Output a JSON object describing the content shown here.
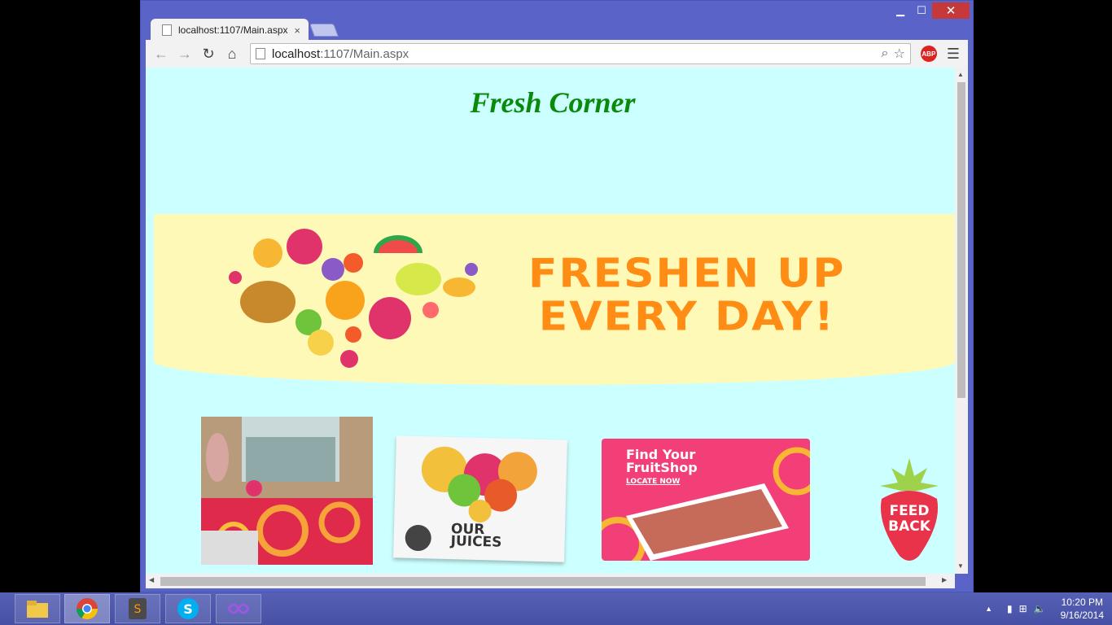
{
  "browser": {
    "tab_title": "localhost:1107/Main.aspx",
    "tab_close": "×",
    "url_host": "localhost",
    "url_rest": ":1107/Main.aspx",
    "abp_label": "ABP"
  },
  "page": {
    "site_title": "Fresh Corner",
    "banner_line1": "FRESHEN UP",
    "banner_line2": "EVERY DAY!",
    "juices_line1": "OUR",
    "juices_line2": "JUICES",
    "find_line1": "Find Your",
    "find_line2": "FruitShop",
    "find_sub": "LOCATE NOW",
    "feedback_line1": "FEED",
    "feedback_line2": "BACK"
  },
  "taskbar": {
    "apps": [
      "file-explorer",
      "chrome",
      "sublime-text",
      "skype",
      "visual-studio"
    ],
    "time": "10:20 PM",
    "date": "9/16/2014"
  },
  "colors": {
    "page_bg": "#ccffff",
    "title_green": "#0a8a0a",
    "banner_bg": "#fff9b8",
    "banner_text": "#ff8c14",
    "find_pink": "#f33f78",
    "window_frame": "#5a64c8"
  }
}
